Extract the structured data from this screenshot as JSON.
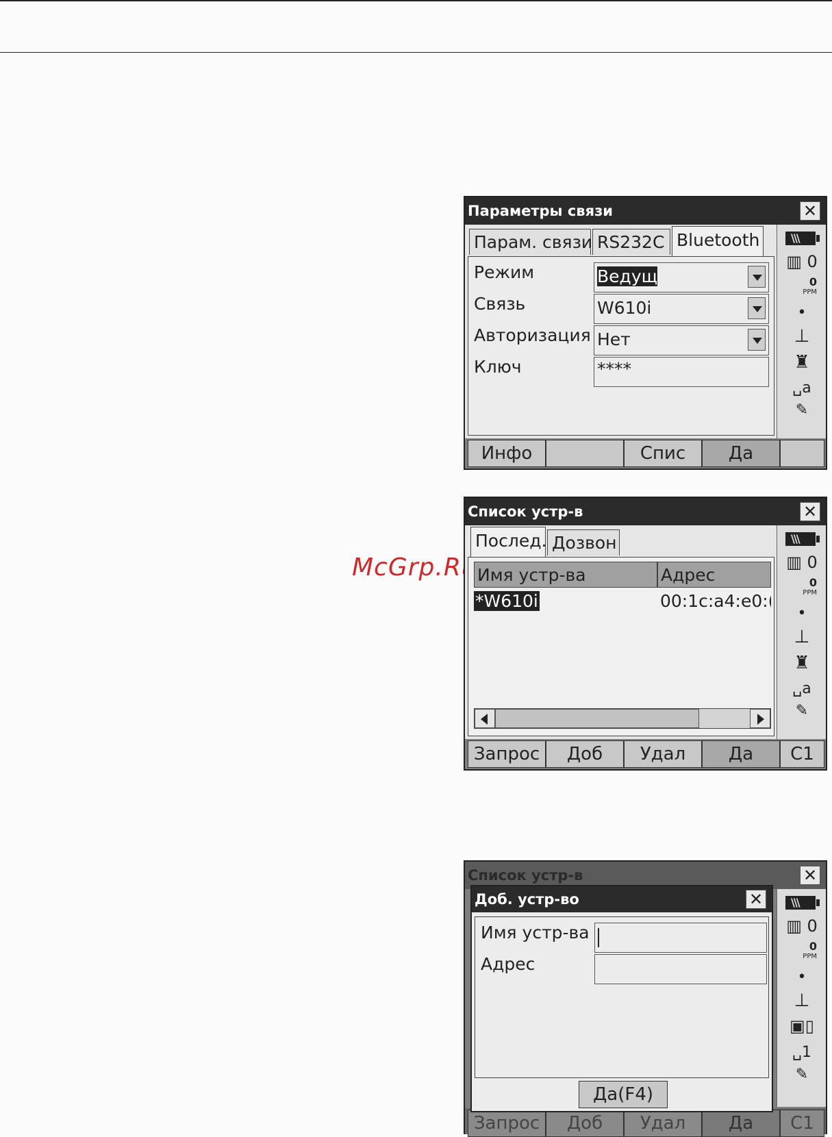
{
  "screen1": {
    "title": "Параметры связи",
    "tabs": [
      "Парам. связи",
      "RS232C",
      "Bluetooth"
    ],
    "fields": [
      {
        "label": "Режим",
        "value": "Ведущ"
      },
      {
        "label": "Связь",
        "value": "W610i"
      },
      {
        "label": "Авторизация",
        "value": "Нет"
      },
      {
        "label": "Ключ",
        "value": "****"
      }
    ],
    "fkeys": [
      "Инфо",
      "",
      "Спис",
      "Да",
      ""
    ]
  },
  "screen2": {
    "title": "Список устр-в",
    "tabs": [
      "Послед.",
      "Дозвон"
    ],
    "columns": [
      "Имя устр-ва",
      "Адрес"
    ],
    "rows": [
      {
        "name": "*W610i",
        "address": "00:1c:a4:e0:("
      }
    ],
    "fkeys": [
      "Запрос",
      "Доб",
      "Удал",
      "Да",
      "C1"
    ]
  },
  "screen3": {
    "bg_title": "Список устр-в",
    "dialog_title": "Доб. устр-во",
    "fields": [
      {
        "label": "Имя устр-ва",
        "value": ""
      },
      {
        "label": "Адрес",
        "value": ""
      }
    ],
    "ok_button": "Да(F4)",
    "fkeys": [
      "Запрос",
      "Доб",
      "Удал",
      "Да",
      "C1"
    ]
  },
  "sidebar": {
    "prism_const": "0",
    "ppm_value": "0",
    "ppm_label": "PPM",
    "dot": "•",
    "target_label": "a",
    "target_label_dialog": "1"
  },
  "watermark": "McGrp.Ru"
}
